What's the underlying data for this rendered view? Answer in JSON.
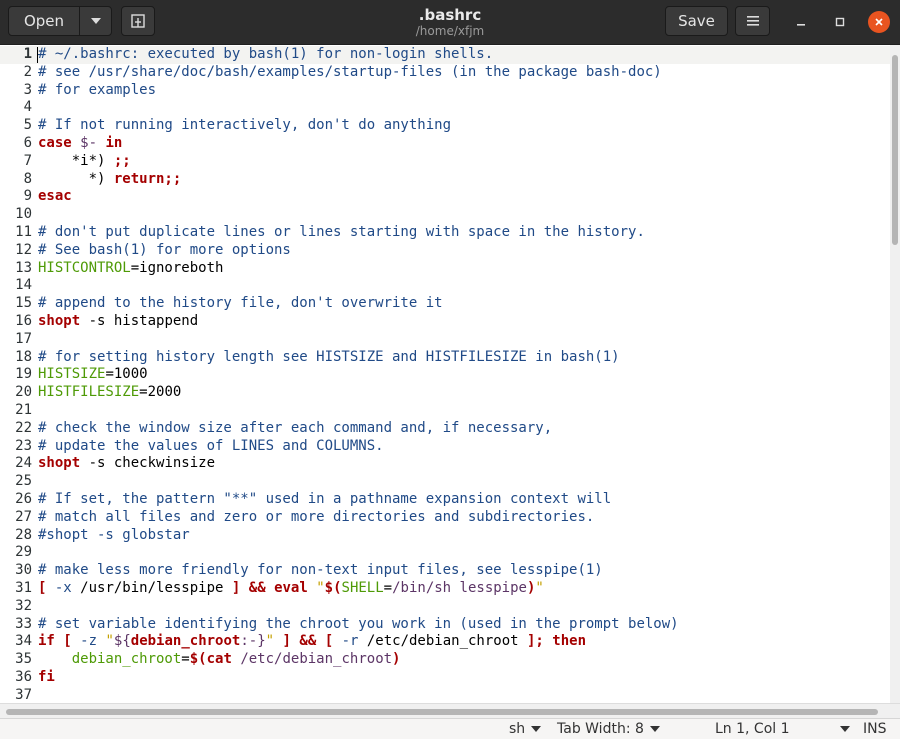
{
  "header": {
    "open_label": "Open",
    "save_label": "Save",
    "title": ".bashrc",
    "subtitle": "/home/xfjm"
  },
  "editor": {
    "lines": [
      [
        [
          "c",
          "# ~/.bashrc: executed by bash(1) for non-login shells."
        ]
      ],
      [
        [
          "c",
          "# see /usr/share/doc/bash/examples/startup-files (in the package bash-doc)"
        ]
      ],
      [
        [
          "c",
          "# for examples"
        ]
      ],
      [],
      [
        [
          "c",
          "# If not running interactively, don't do anything"
        ]
      ],
      [
        [
          "k",
          "case"
        ],
        [
          "n",
          " "
        ],
        [
          "p",
          "$-"
        ],
        [
          "n",
          " "
        ],
        [
          "k",
          "in"
        ]
      ],
      [
        [
          "n",
          "    *i*) "
        ],
        [
          "k",
          ";;"
        ]
      ],
      [
        [
          "n",
          "      *) "
        ],
        [
          "k",
          "return;;"
        ]
      ],
      [
        [
          "k",
          "esac"
        ]
      ],
      [],
      [
        [
          "c",
          "# don't put duplicate lines or lines starting with space in the history."
        ]
      ],
      [
        [
          "c",
          "# See bash(1) for more options"
        ]
      ],
      [
        [
          "v",
          "HISTCONTROL"
        ],
        [
          "n",
          "=ignoreboth"
        ]
      ],
      [],
      [
        [
          "c",
          "# append to the history file, don't overwrite it"
        ]
      ],
      [
        [
          "k",
          "shopt"
        ],
        [
          "n",
          " -s histappend"
        ]
      ],
      [],
      [
        [
          "c",
          "# for setting history length see HISTSIZE and HISTFILESIZE in bash(1)"
        ]
      ],
      [
        [
          "v",
          "HISTSIZE"
        ],
        [
          "n",
          "=1000"
        ]
      ],
      [
        [
          "v",
          "HISTFILESIZE"
        ],
        [
          "n",
          "=2000"
        ]
      ],
      [],
      [
        [
          "c",
          "# check the window size after each command and, if necessary,"
        ]
      ],
      [
        [
          "c",
          "# update the values of LINES and COLUMNS."
        ]
      ],
      [
        [
          "k",
          "shopt"
        ],
        [
          "n",
          " -s checkwinsize"
        ]
      ],
      [],
      [
        [
          "c",
          "# If set, the pattern \"**\" used in a pathname expansion context will"
        ]
      ],
      [
        [
          "c",
          "# match all files and zero or more directories and subdirectories."
        ]
      ],
      [
        [
          "c",
          "#shopt -s globstar"
        ]
      ],
      [],
      [
        [
          "c",
          "# make less more friendly for non-text input files, see lesspipe(1)"
        ]
      ],
      [
        [
          "k",
          "["
        ],
        [
          "n",
          " "
        ],
        [
          "o",
          "-x"
        ],
        [
          "n",
          " /usr/bin/lesspipe "
        ],
        [
          "k",
          "]"
        ],
        [
          "n",
          " "
        ],
        [
          "k",
          "&&"
        ],
        [
          "n",
          " "
        ],
        [
          "k",
          "eval"
        ],
        [
          "n",
          " "
        ],
        [
          "s",
          "\""
        ],
        [
          "k",
          "$("
        ],
        [
          "v",
          "SHELL"
        ],
        [
          "n",
          "="
        ],
        [
          "p",
          "/bin/sh lesspipe"
        ],
        [
          "k",
          ")"
        ],
        [
          "s",
          "\""
        ]
      ],
      [],
      [
        [
          "c",
          "# set variable identifying the chroot you work in (used in the prompt below)"
        ]
      ],
      [
        [
          "k",
          "if"
        ],
        [
          "n",
          " "
        ],
        [
          "k",
          "["
        ],
        [
          "n",
          " "
        ],
        [
          "o",
          "-z"
        ],
        [
          "n",
          " "
        ],
        [
          "s",
          "\""
        ],
        [
          "p",
          "${"
        ],
        [
          "k",
          "debian_chroot"
        ],
        [
          "p",
          ":-}"
        ],
        [
          "s",
          "\""
        ],
        [
          "n",
          " "
        ],
        [
          "k",
          "]"
        ],
        [
          "n",
          " "
        ],
        [
          "k",
          "&&"
        ],
        [
          "n",
          " "
        ],
        [
          "k",
          "["
        ],
        [
          "n",
          " "
        ],
        [
          "o",
          "-r"
        ],
        [
          "n",
          " /etc/debian_chroot "
        ],
        [
          "k",
          "];"
        ],
        [
          "n",
          " "
        ],
        [
          "k",
          "then"
        ]
      ],
      [
        [
          "n",
          "    "
        ],
        [
          "v",
          "debian_chroot"
        ],
        [
          "n",
          "="
        ],
        [
          "k",
          "$(cat"
        ],
        [
          "n",
          " "
        ],
        [
          "p",
          "/etc/debian_chroot"
        ],
        [
          "k",
          ")"
        ]
      ],
      [
        [
          "k",
          "fi"
        ]
      ],
      []
    ]
  },
  "status": {
    "language": "sh",
    "tab_width": "Tab Width: 8",
    "position": "Ln 1, Col 1",
    "mode": "INS"
  }
}
